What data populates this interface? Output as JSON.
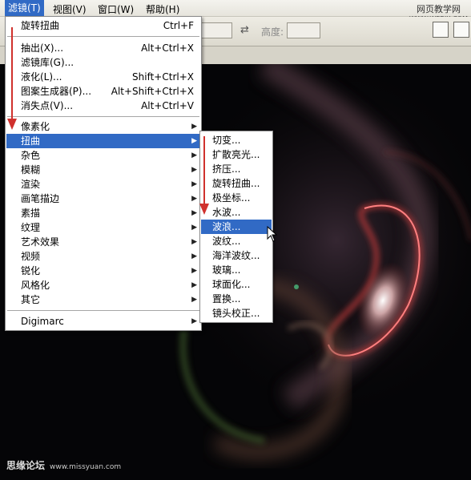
{
  "menubar": {
    "items": [
      "滤镜(T)",
      "视图(V)",
      "窗口(W)",
      "帮助(H)"
    ],
    "active_index": 0
  },
  "watermark_top": {
    "line1": "网页教学网",
    "line2": "WWW.WEBJX.COM"
  },
  "optbar": {
    "height_label": "高度:"
  },
  "filter_menu": {
    "top_items": [
      {
        "label": "旋转扭曲",
        "shortcut": "Ctrl+F"
      }
    ],
    "mid_items": [
      {
        "label": "抽出(X)...",
        "shortcut": "Alt+Ctrl+X"
      },
      {
        "label": "滤镜库(G)...",
        "shortcut": ""
      },
      {
        "label": "液化(L)...",
        "shortcut": "Shift+Ctrl+X"
      },
      {
        "label": "图案生成器(P)...",
        "shortcut": "Alt+Shift+Ctrl+X"
      },
      {
        "label": "消失点(V)...",
        "shortcut": "Alt+Ctrl+V"
      }
    ],
    "sub_items": [
      {
        "label": "像素化"
      },
      {
        "label": "扭曲"
      },
      {
        "label": "杂色"
      },
      {
        "label": "模糊"
      },
      {
        "label": "渲染"
      },
      {
        "label": "画笔描边"
      },
      {
        "label": "素描"
      },
      {
        "label": "纹理"
      },
      {
        "label": "艺术效果"
      },
      {
        "label": "视频"
      },
      {
        "label": "锐化"
      },
      {
        "label": "风格化"
      },
      {
        "label": "其它"
      }
    ],
    "selected_index": 1,
    "bottom_items": [
      {
        "label": "Digimarc"
      }
    ]
  },
  "distort_submenu": {
    "items": [
      "切变...",
      "扩散亮光...",
      "挤压...",
      "旋转扭曲...",
      "极坐标...",
      "水波...",
      "波浪...",
      "波纹...",
      "海洋波纹...",
      "玻璃...",
      "球面化...",
      "置换...",
      "镜头校正..."
    ],
    "selected_index": 6
  },
  "watermark_bottom": {
    "text": "思缘论坛",
    "url": "www.missyuan.com"
  },
  "colors": {
    "highlight": "#316ac5",
    "arrow": "#d0312d"
  }
}
